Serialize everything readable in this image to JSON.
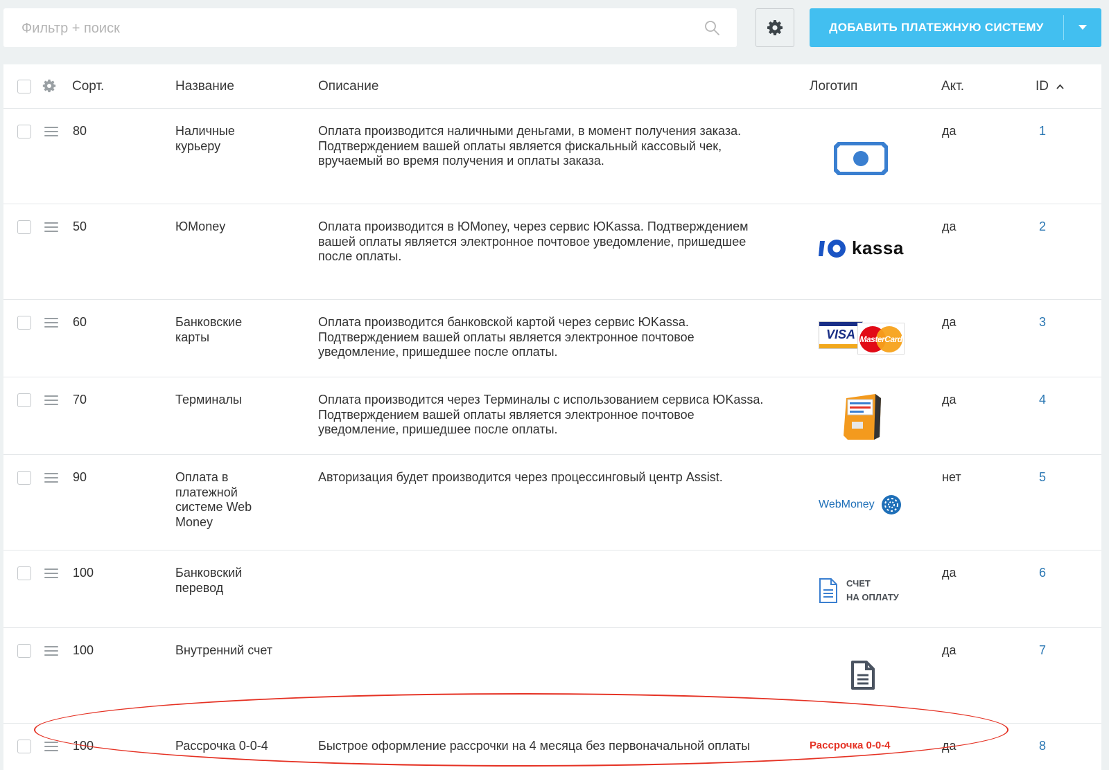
{
  "toolbar": {
    "search_placeholder": "Фильтр + поиск",
    "search_value": "",
    "settings_icon": "gear-icon",
    "add_button_label": "ДОБАВИТЬ ПЛАТЕЖНУЮ СИСТЕМУ",
    "add_button_color": "#42bff0"
  },
  "table": {
    "columns": {
      "sort": "Сорт.",
      "name": "Название",
      "description": "Описание",
      "logo": "Логотип",
      "active": "Акт.",
      "id": "ID"
    },
    "rows": [
      {
        "sort": "80",
        "name": "Наличные курьеру",
        "description": "Оплата производится наличными деньгами, в момент получения заказа. Подтверждением вашей оплаты является фискальный кассовый чек, вручаемый во время получения и оплаты заказа.",
        "logo": "cash-icon",
        "active": "да",
        "id": "1"
      },
      {
        "sort": "50",
        "name": "ЮMoney",
        "description": "Оплата производится в ЮMoney, через сервис ЮKassa. Подтверждением вашей оплаты является электронное почтовое уведомление, пришедшее после оплаты.",
        "logo": "yookassa-logo",
        "logo_text": "kassa",
        "active": "да",
        "id": "2"
      },
      {
        "sort": "60",
        "name": "Банковские карты",
        "description": "Оплата производится банковской картой через сервис ЮKassa. Подтверждением вашей оплаты является электронное почтовое уведомление, пришедшее после оплаты.",
        "logo": "visa-mastercard-logo",
        "logo_text_visa": "VISA",
        "logo_text_mc": "MasterCard",
        "active": "да",
        "id": "3"
      },
      {
        "sort": "70",
        "name": "Терминалы",
        "description": "Оплата производится через Терминалы с использованием сервиса ЮKassa. Подтверждением вашей оплаты является электронное почтовое уведомление, пришедшее после оплаты.",
        "logo": "terminal-icon",
        "active": "да",
        "id": "4"
      },
      {
        "sort": "90",
        "name": "Оплата в платежной системе Web Money",
        "description": "Авторизация будет производится через процессинговый центр Assist.",
        "logo": "webmoney-logo",
        "logo_text": "WebMoney",
        "active": "нет",
        "id": "5"
      },
      {
        "sort": "100",
        "name": "Банковский перевод",
        "description": "",
        "logo": "invoice-logo",
        "logo_text_1": "СЧЕТ",
        "logo_text_2": "НА ОПЛАТУ",
        "active": "да",
        "id": "6"
      },
      {
        "sort": "100",
        "name": "Внутренний счет",
        "description": "",
        "logo": "document-icon",
        "active": "да",
        "id": "7"
      },
      {
        "sort": "100",
        "name": "Рассрочка 0-0-4",
        "description": "Быстрое оформление рассрочки на 4 месяца без первоначальной оплаты",
        "logo": "installment-logo",
        "logo_text": "Рассрочка 0-0-4",
        "active": "да",
        "id": "8"
      }
    ]
  },
  "colors": {
    "accent": "#42bff0",
    "link": "#2a77b3",
    "highlight": "#e53224",
    "logo_blue": "#3a7fd0"
  }
}
